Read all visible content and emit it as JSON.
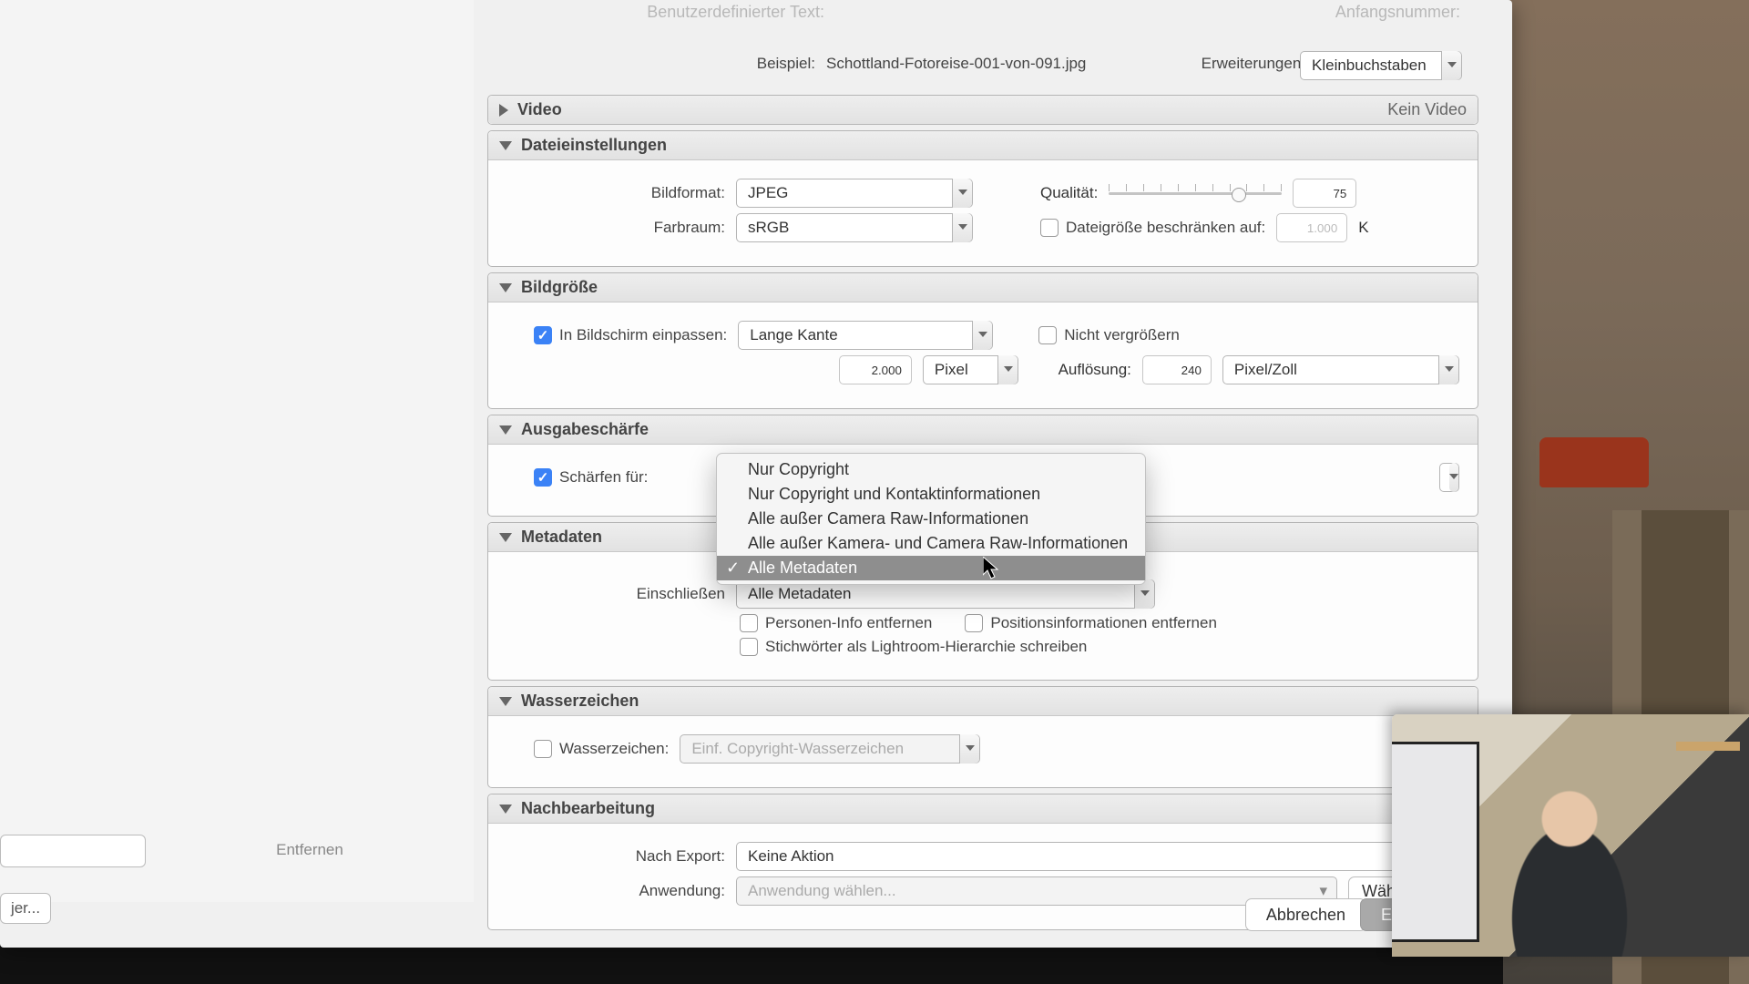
{
  "top": {
    "custom_text_label": "Benutzerdefinierter Text:",
    "start_number_label": "Anfangsnummer:",
    "example_label": "Beispiel:",
    "example_value": "Schottland-Fotoreise-001-von-091.jpg",
    "extensions_label": "Erweiterungen:",
    "extensions_value": "Kleinbuchstaben"
  },
  "video": {
    "title": "Video",
    "status": "Kein Video"
  },
  "file": {
    "title": "Dateieinstellungen",
    "format_label": "Bildformat:",
    "format_value": "JPEG",
    "quality_label": "Qualität:",
    "quality_value": "75",
    "colorspace_label": "Farbraum:",
    "colorspace_value": "sRGB",
    "limit_label": "Dateigröße beschränken auf:",
    "limit_value": "1.000",
    "limit_unit": "K"
  },
  "size": {
    "title": "Bildgröße",
    "fit_label": "In Bildschirm einpassen:",
    "fit_value": "Lange Kante",
    "noenlarge_label": "Nicht vergrößern",
    "dim_value": "2.000",
    "dim_unit": "Pixel",
    "res_label": "Auflösung:",
    "res_value": "240",
    "res_unit": "Pixel/Zoll"
  },
  "sharpen": {
    "title": "Ausgabeschärfe",
    "for_label": "Schärfen für:"
  },
  "meta": {
    "title": "Metadaten",
    "include_label": "Einschließen",
    "options": [
      "Nur Copyright",
      "Nur Copyright und Kontaktinformationen",
      "Alle außer Camera Raw-Informationen",
      "Alle außer Kamera- und Camera Raw-Informationen",
      "Alle Metadaten"
    ],
    "selected_index": 4,
    "remove_person_label": "Personen-Info entfernen",
    "remove_position_label": "Positionsinformationen entfernen",
    "keywords_label": "Stichwörter als Lightroom-Hierarchie schreiben"
  },
  "watermark": {
    "title": "Wasserzeichen",
    "checkbox_label": "Wasserzeichen:",
    "preset": "Einf. Copyright-Wasserzeichen"
  },
  "post": {
    "title": "Nachbearbeitung",
    "after_label": "Nach Export:",
    "after_value": "Keine Aktion",
    "app_label": "Anwendung:",
    "app_placeholder": "Anwendung wählen...",
    "choose_btn": "Wähle"
  },
  "left": {
    "remove": "Entfernen",
    "small": "jer..."
  },
  "footer": {
    "cancel": "Abbrechen",
    "export": "Exp"
  }
}
